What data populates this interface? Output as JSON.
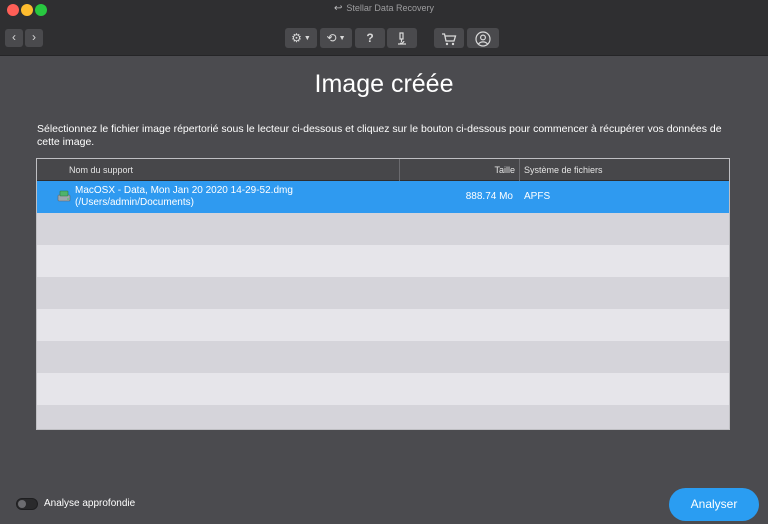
{
  "window": {
    "title": "Stellar Data Recovery"
  },
  "toolbar": {
    "back": "‹",
    "forward": "›",
    "settings_icon": "gear-icon",
    "history_icon": "clock-icon",
    "help_label": "?",
    "tools_icon": "microscope-icon",
    "cart_icon": "cart-icon",
    "account_icon": "user-icon"
  },
  "page": {
    "title": "Image créée",
    "instruction": "Sélectionnez le fichier image répertorié sous le lecteur ci-dessous et cliquez sur le bouton ci-dessous pour commencer à récupérer vos données de cette image."
  },
  "table": {
    "columns": {
      "name": "Nom du support",
      "size": "Taille",
      "filesystem": "Système de fichiers"
    },
    "rows": [
      {
        "name_line1": "MacOSX - Data, Mon Jan 20 2020 14-29-52.dmg",
        "name_line2": "(/Users/admin/Documents)",
        "size": "888.74 Mo",
        "filesystem": "APFS",
        "selected": true
      }
    ]
  },
  "footer": {
    "deep_scan_label": "Analyse approfondie",
    "deep_scan_on": false,
    "analyse_button": "Analyser"
  },
  "colors": {
    "accent": "#2f9af0",
    "background": "#4b4b4f",
    "toolbar": "#2f2f31"
  }
}
